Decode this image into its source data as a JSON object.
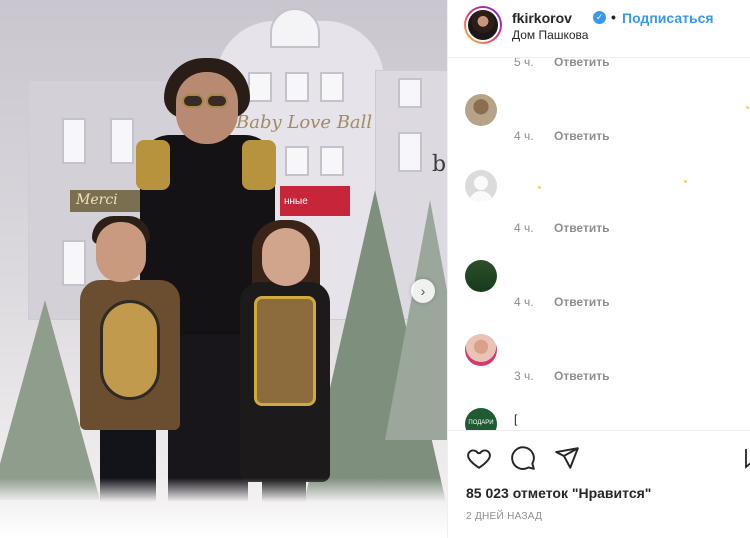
{
  "post": {
    "username": "fkirkorov",
    "verified_mark": "✓",
    "separator": "•",
    "follow_label": "Подписаться",
    "location": "Дом Пашкова"
  },
  "photo": {
    "sign_baby": "Baby Love Ball",
    "sign_merci": "Merci",
    "sign_red": "нные",
    "sign_ba": "b",
    "next_glyph": "›"
  },
  "comments": [
    {
      "time": "5 ч.",
      "reply": "Ответить",
      "avatar": "none"
    },
    {
      "time": "4 ч.",
      "reply": "Ответить",
      "avatar": "user-photo-icon"
    },
    {
      "time": "4 ч.",
      "reply": "Ответить",
      "avatar": "default-avatar-icon"
    },
    {
      "time": "4 ч.",
      "reply": "Ответить",
      "avatar": "user-photo-icon"
    },
    {
      "time": "3 ч.",
      "reply": "Ответить",
      "avatar": "user-photo-icon"
    },
    {
      "time": "",
      "reply": "",
      "avatar": "user-photo-icon",
      "snippet": "["
    }
  ],
  "avatar5_text": "ПОДАРИ",
  "actions": {
    "like_icon": "heart-icon",
    "comment_icon": "comment-icon",
    "share_icon": "share-icon",
    "save_icon": "bookmark-icon"
  },
  "likes_text": "85 023 отметок \"Нравится\"",
  "date_text": "2 ДНЕЙ НАЗАД",
  "colors": {
    "link": "#3897f0",
    "muted": "#8e8e8e",
    "text": "#262626"
  }
}
